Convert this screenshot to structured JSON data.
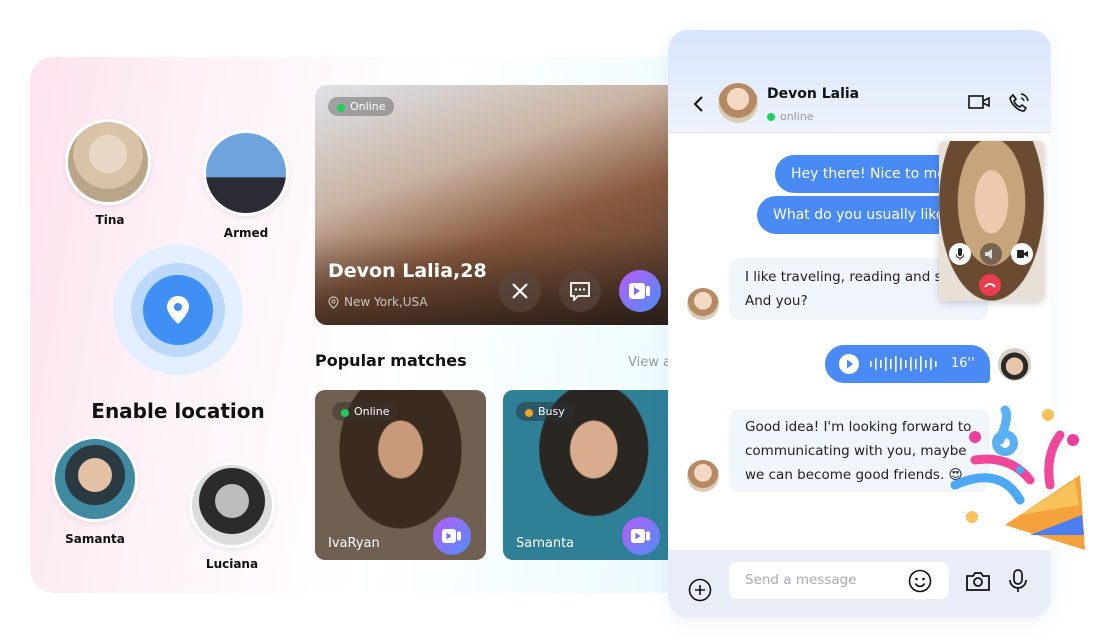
{
  "nearby": {
    "people": [
      {
        "name": "Tina"
      },
      {
        "name": "Armed"
      },
      {
        "name": "Samanta"
      },
      {
        "name": "Luciana"
      }
    ],
    "enable_location_label": "Enable location",
    "location_icon": "map-pin-icon",
    "accent": "#3f8ff5"
  },
  "profile_card": {
    "status": "Online",
    "name_age": "Devon Lalia,28",
    "location": "New York,USA",
    "actions": [
      "close-icon",
      "chat-icon",
      "video-call-icon"
    ]
  },
  "popular": {
    "title": "Popular matches",
    "view_all": "View a",
    "cards": [
      {
        "name": "IvaRyan",
        "status": "Online",
        "status_color": "#22c55e"
      },
      {
        "name": "Samanta",
        "status": "Busy",
        "status_color": "#f5a524"
      }
    ]
  },
  "chat": {
    "contact_name": "Devon Lalia",
    "contact_status": "online",
    "messages": [
      {
        "from": "me",
        "text": "Hey there! Nice to meet you"
      },
      {
        "from": "me",
        "text": "What do you usually like to do?"
      },
      {
        "from": "them",
        "text": "I like traveling, reading and sports.",
        "text2": "And you?"
      },
      {
        "from": "me",
        "type": "voice",
        "duration": "16''"
      },
      {
        "from": "them",
        "lines": [
          "Good idea! I'm looking forward to",
          "communicating with you, maybe",
          "we can become good friends. 😍"
        ]
      }
    ],
    "input_placeholder": "Send a message",
    "bubble_color": "#4a8af4"
  }
}
